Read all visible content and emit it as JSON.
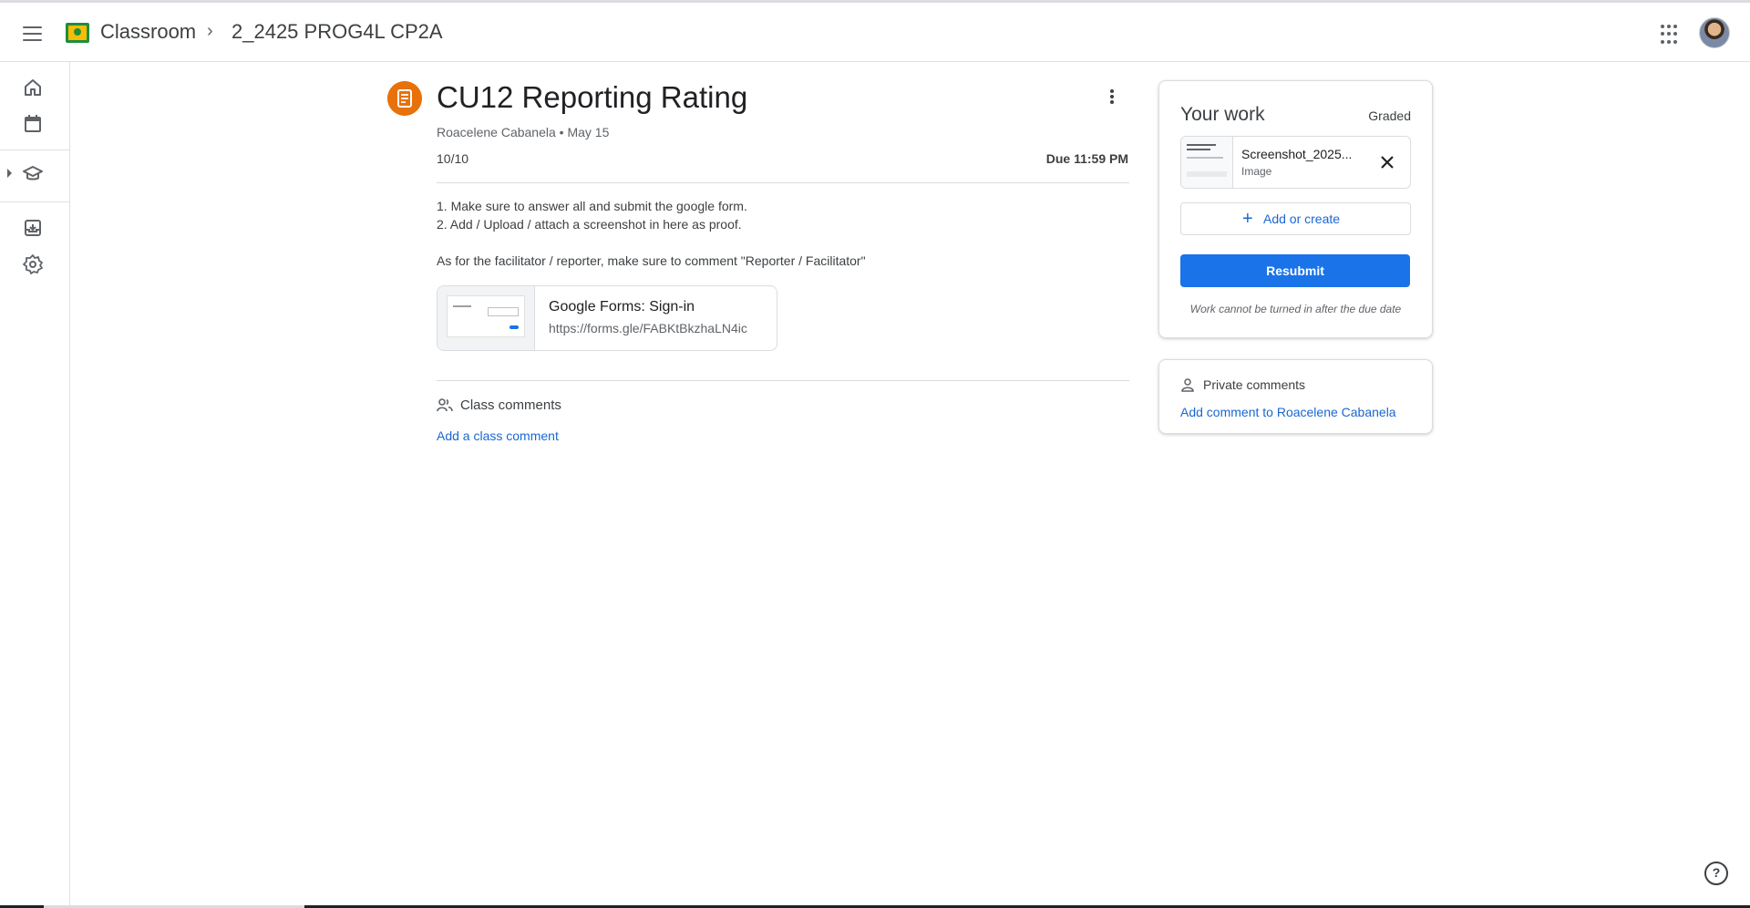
{
  "header": {
    "brand": "Classroom",
    "breadcrumb_separator": "›",
    "class_name": "2_2425 PROG4L CP2A"
  },
  "assignment": {
    "title": "CU12 Reporting Rating",
    "meta": "Roacelene Cabanela • May 15",
    "points": "10/10",
    "due": "Due 11:59 PM",
    "instructions": [
      "1. Make sure to answer all and submit the google form.",
      "2. Add / Upload / attach a screenshot in here as proof.",
      "As for the facilitator / reporter, make sure to comment \"Reporter / Facilitator\""
    ],
    "attachment": {
      "title": "Google Forms: Sign-in",
      "url": "https://forms.gle/FABKtBkzhaLN4ic"
    },
    "class_comments_label": "Class comments",
    "add_class_comment": "Add a class comment"
  },
  "your_work": {
    "title": "Your work",
    "status": "Graded",
    "file": {
      "name": "Screenshot_2025...",
      "type": "Image"
    },
    "add_or_create": "Add or create",
    "resubmit": "Resubmit",
    "note": "Work cannot be turned in after the due date"
  },
  "private_comments": {
    "label": "Private comments",
    "add_link": "Add comment to Roacelene Cabanela"
  },
  "help": "?",
  "colors": {
    "accent_blue": "#1a73e8",
    "link_blue": "#1967d2",
    "assignment_orange": "#e8710a",
    "classroom_green": "#1e8e3e"
  }
}
